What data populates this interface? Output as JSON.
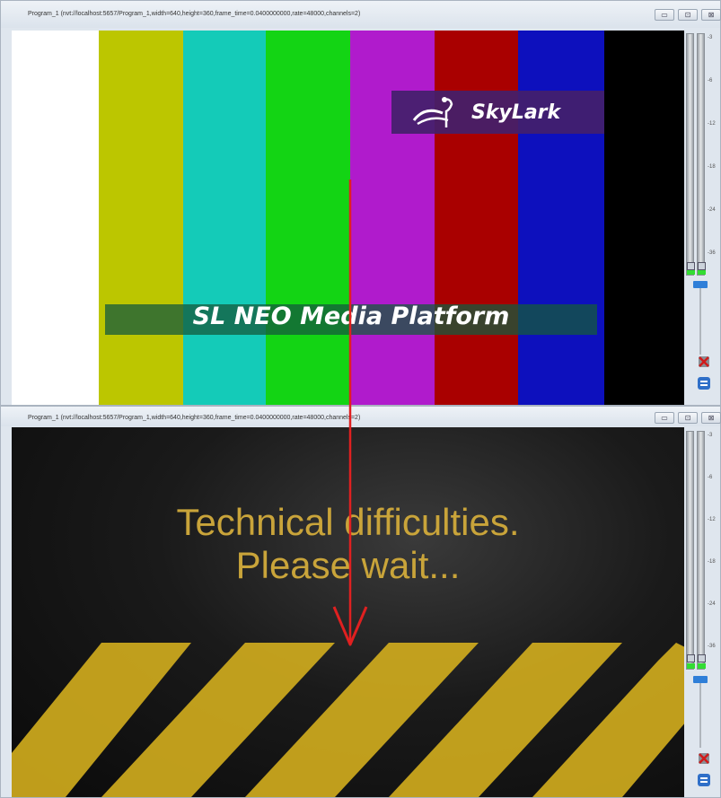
{
  "window_top": {
    "title": "Program_1 (nvt://localhost:5657/Program_1,width=640,height=360,frame_time=0.0400000000,rate=48000,channels=2)",
    "controls": [
      "▭",
      "⊡",
      "⊠"
    ],
    "logo_text": "SkyLark",
    "banner_text": "SL NEO Media Platform",
    "meter_scale": [
      "-3",
      "-6",
      "-12",
      "-18",
      "-24",
      "-36"
    ],
    "colors": [
      "#ffffff",
      "#bcc600",
      "#14cbb8",
      "#13d414",
      "#b01bcc",
      "#a90000",
      "#0d10bd",
      "#000000"
    ]
  },
  "window_bottom": {
    "title": "Program_1 (nvt://localhost:5657/Program_1,width=640,height=360,frame_time=0.0400000000,rate=48000,channels=2)",
    "controls": [
      "▭",
      "⊡",
      "⊠"
    ],
    "message_line1": "Technical difficulties.",
    "message_line2": "Please wait...",
    "meter_scale": [
      "-3",
      "-6",
      "-12",
      "-18",
      "-24",
      "-36"
    ]
  },
  "accent_colors": {
    "arrow": "#e02020",
    "hazard_yellow": "#d8b21e",
    "slider_thumb": "#2f7fd8",
    "meter_green": "#33dd33"
  },
  "icons": [
    "minimize-icon",
    "restore-icon",
    "close-icon",
    "mute-icon",
    "stack-icon",
    "meter-toggle-icon"
  ]
}
